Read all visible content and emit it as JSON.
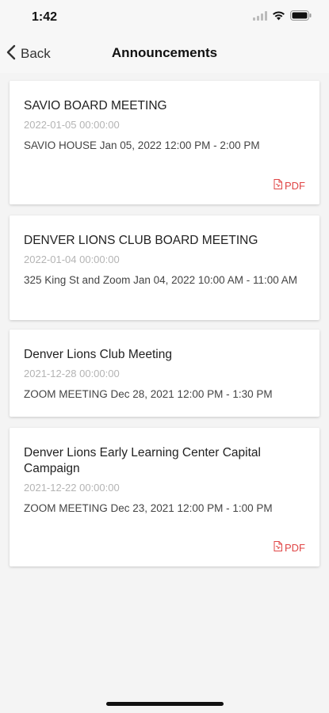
{
  "status_bar": {
    "time": "1:42",
    "icons": [
      "signal-icon",
      "wifi-icon",
      "battery-icon"
    ]
  },
  "nav": {
    "back_label": "Back",
    "title": "Announcements"
  },
  "accent_color": "#e04545",
  "announcements": [
    {
      "title": "SAVIO BOARD MEETING",
      "date": "2022-01-05 00:00:00",
      "description": "SAVIO HOUSE Jan 05, 2022 12:00 PM - 2:00 PM",
      "pdf_label": "PDF"
    },
    {
      "title": "DENVER LIONS CLUB BOARD MEETING",
      "date": "2022-01-04 00:00:00",
      "description": "325 King St and Zoom Jan 04, 2022 10:00 AM - 11:00 AM"
    },
    {
      "title": "Denver Lions Club Meeting",
      "date": "2021-12-28 00:00:00",
      "description": "ZOOM MEETING Dec 28, 2021 12:00 PM - 1:30 PM"
    },
    {
      "title": "Denver Lions Early Learning Center Capital Campaign",
      "date": "2021-12-22 00:00:00",
      "description": "ZOOM MEETING Dec 23, 2021 12:00 PM - 1:00 PM",
      "pdf_label": "PDF"
    }
  ]
}
